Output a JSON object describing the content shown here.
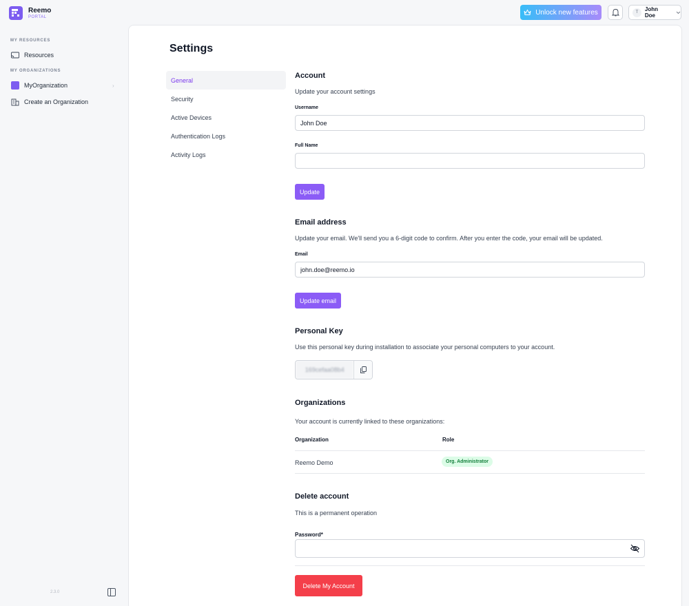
{
  "brand": {
    "name": "Reemo",
    "sub": "PORTAL"
  },
  "header": {
    "unlock_label": "Unlock new features",
    "user_initial": "T",
    "user_name": "John Doe"
  },
  "sidebar": {
    "section_resources": "MY RESOURCES",
    "resources_label": "Resources",
    "section_orgs": "MY ORGANIZATIONS",
    "org_label": "MyOrganization",
    "create_org_label": "Create an Organization",
    "version": "2.3.0"
  },
  "settings": {
    "title": "Settings",
    "nav": [
      "General",
      "Security",
      "Active Devices",
      "Authentication Logs",
      "Activity Logs"
    ]
  },
  "account": {
    "title": "Account",
    "subtitle": "Update your account settings",
    "username_label": "Username",
    "username_value": "John Doe",
    "fullname_label": "Full Name",
    "fullname_value": "",
    "update_label": "Update"
  },
  "email": {
    "title": "Email address",
    "subtitle": "Update your email. We'll send you a 6-digit code to confirm. After you enter the code, your email will be updated.",
    "email_label": "Email",
    "email_value": "john.doe@reemo.io",
    "update_label": "Update email"
  },
  "personal_key": {
    "title": "Personal Key",
    "subtitle": "Use this personal key during installation to associate your personal computers to your account.",
    "value": "169cefaa08b4"
  },
  "organizations": {
    "title": "Organizations",
    "subtitle": "Your account is currently linked to these organizations:",
    "col_org": "Organization",
    "col_role": "Role",
    "rows": [
      {
        "org": "Reemo Demo",
        "role": "Org. Administrator"
      }
    ]
  },
  "delete": {
    "title": "Delete account",
    "subtitle": "This is a permanent operation",
    "password_label": "Password*",
    "button_label": "Delete My Account"
  },
  "colors": {
    "accent": "#8b5cf6",
    "danger": "#f43f4a",
    "badge_bg": "#dcfce7",
    "badge_text": "#15803d"
  }
}
